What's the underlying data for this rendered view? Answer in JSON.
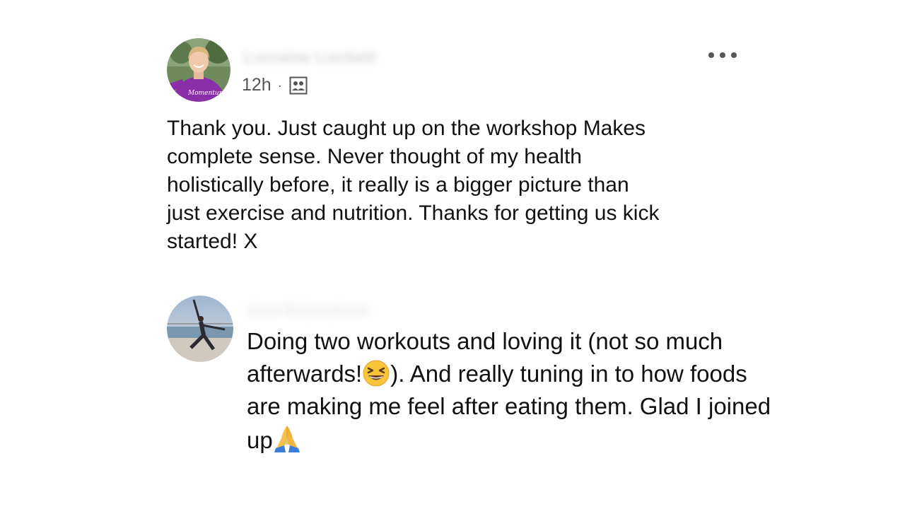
{
  "post": {
    "author_name": "Lorraine Lockett",
    "timestamp": "12h",
    "separator": "·",
    "audience_icon": "group-audience-icon",
    "more_icon": "more-options-icon",
    "text": "Thank you. Just caught up on the workshop Makes\ncomplete sense. Never thought of my health\nholistically before, it really is a bigger picture than\njust exercise and nutrition. Thanks for getting us kick\nstarted! X"
  },
  "comment": {
    "author_name": "Lisa Richardson",
    "text_part1": "Doing two workouts and loving it (not so much afterwards!",
    "emoji1": "grinning-squinting-face",
    "text_part2": "). And really tuning in to how foods are making me feel after eating them. Glad I joined up",
    "emoji2": "folded-hands"
  },
  "colors": {
    "background": "#ffffff",
    "text": "#111111",
    "meta": "#555555",
    "avatar1_accent": "#8a2fa8"
  }
}
